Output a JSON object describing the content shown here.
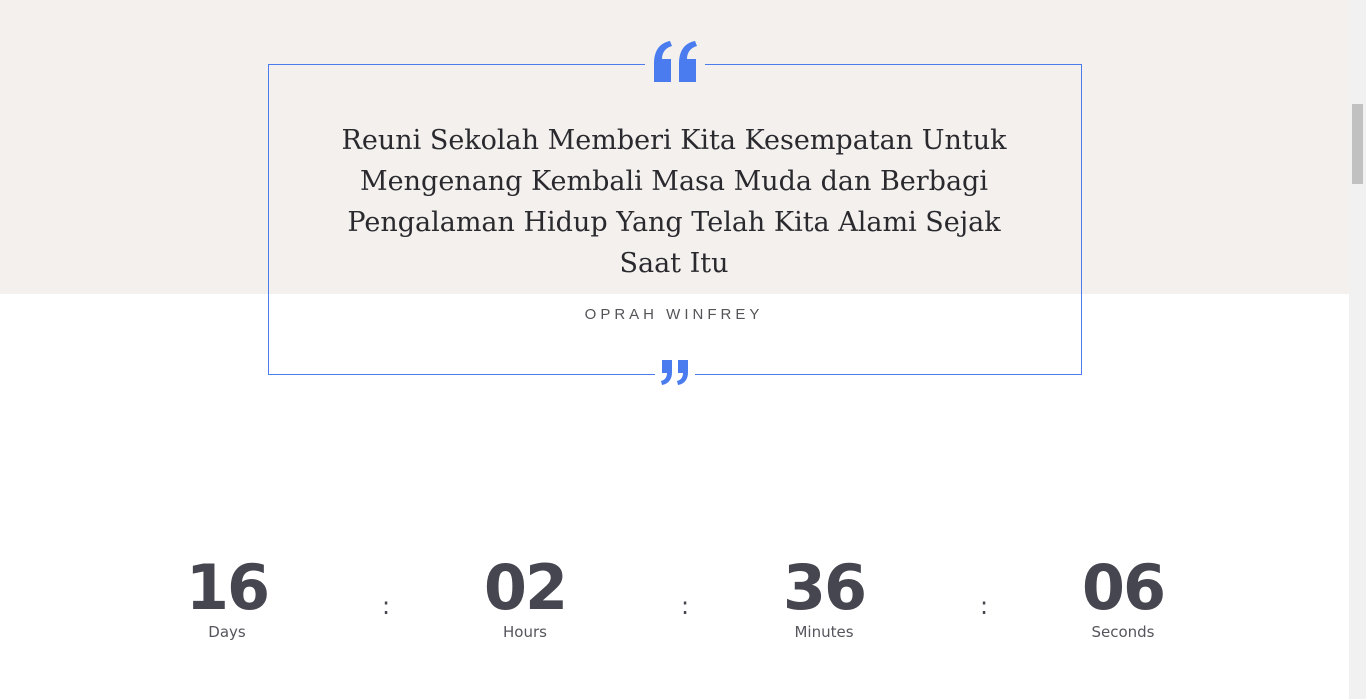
{
  "quote": {
    "text": "Reuni Sekolah Memberi Kita Kesempatan Untuk Mengenang Kembali Masa Muda dan Berbagi Pengalaman Hidup Yang Telah Kita Alami Sejak Saat Itu",
    "author": "OPRAH WINFREY",
    "open_icon": "quote-open-icon",
    "close_icon": "quote-close-icon"
  },
  "countdown": {
    "days": {
      "value": "16",
      "label": "Days"
    },
    "hours": {
      "value": "02",
      "label": "Hours"
    },
    "minutes": {
      "value": "36",
      "label": "Minutes"
    },
    "seconds": {
      "value": "06",
      "label": "Seconds"
    },
    "separator": ":"
  },
  "colors": {
    "accent": "#4a7cf0",
    "band_background": "#f3f0ee",
    "text_dark": "#464650"
  }
}
